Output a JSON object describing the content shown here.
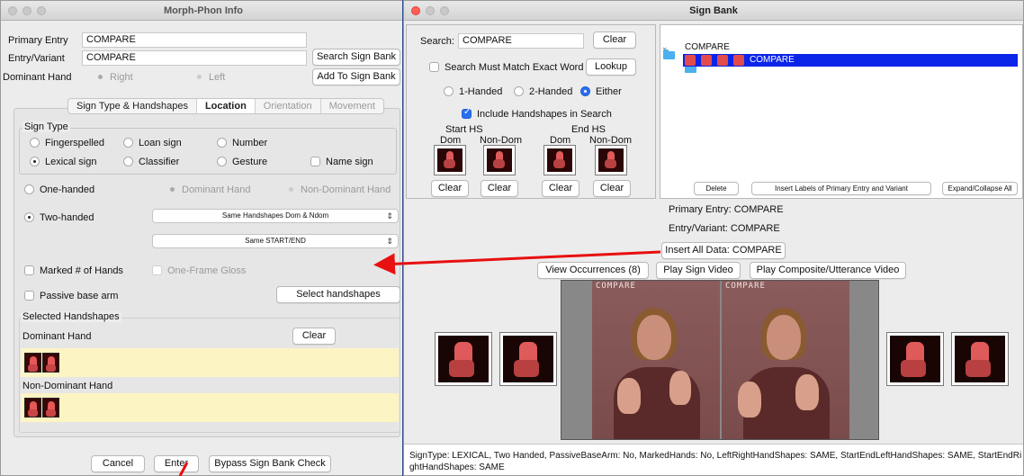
{
  "left_window": {
    "title": "Morph-Phon Info",
    "primary_entry_label": "Primary Entry",
    "primary_entry_value": "COMPARE",
    "entry_variant_label": "Entry/Variant",
    "entry_variant_value": "COMPARE",
    "search_sign_bank": "Search Sign Bank",
    "add_to_sign_bank": "Add To Sign Bank",
    "dominant_hand_label": "Dominant Hand",
    "right": "Right",
    "left": "Left",
    "tabs": [
      "Sign Type & Handshapes",
      "Location",
      "Orientation",
      "Movement"
    ],
    "sign_type_label": "Sign Type",
    "sign_types": [
      "Fingerspelled",
      "Loan sign",
      "Number",
      "Lexical sign",
      "Classifier",
      "Gesture",
      "Name sign"
    ],
    "one_handed": "One-handed",
    "dominant_hand_opt": "Dominant Hand",
    "non_dominant_hand_opt": "Non-Dominant Hand",
    "two_handed": "Two-handed",
    "select1": "Same Handshapes Dom & Ndom",
    "select2": "Same START/END",
    "marked_hands": "Marked # of Hands",
    "one_frame_gloss": "One-Frame Gloss",
    "passive_base_arm": "Passive base arm",
    "select_handshapes": "Select handshapes",
    "selected_handshapes_label": "Selected Handshapes",
    "dominant_hand_section": "Dominant Hand",
    "clear": "Clear",
    "non_dominant_hand_section": "Non-Dominant Hand",
    "cancel": "Cancel",
    "enter": "Enter",
    "bypass": "Bypass Sign Bank Check"
  },
  "right_window": {
    "title": "Sign Bank",
    "search_label": "Search:",
    "search_value": "COMPARE",
    "clear": "Clear",
    "exact_match": "Search Must Match Exact Word",
    "lookup": "Lookup",
    "one_handed": "1-Handed",
    "two_handed": "2-Handed",
    "either": "Either",
    "include_handshapes": "Include Handshapes in Search",
    "start_hs": "Start HS",
    "end_hs": "End HS",
    "dom": "Dom",
    "non_dom": "Non-Dom",
    "tree_root": "COMPARE",
    "tree_item": "COMPARE",
    "delete": "Delete",
    "insert_labels": "Insert Labels of Primary Entry and Variant",
    "expand_collapse": "Expand/Collapse All",
    "primary_entry_line": "Primary Entry: COMPARE",
    "entry_variant_line": "Entry/Variant: COMPARE",
    "insert_all_data": "Insert All Data: COMPARE",
    "view_occurrences": "View Occurrences (8)",
    "play_sign_video": "Play Sign Video",
    "play_composite": "Play Composite/Utterance Video",
    "video_label": "COMPARE",
    "status_line1": "SignType: LEXICAL, Two Handed, PassiveBaseArm: No, MarkedHands: No, LeftRightHandShapes: SAME, StartEndLeftHandShapes: SAME, StartEndRi",
    "status_line2": "ghtHandShapes: SAME"
  },
  "colors": {
    "arrow": "#e81010",
    "tree_selection": "#0a24e8",
    "handshape_panel": "#fdf4c4",
    "accent": "#2a6ff0"
  }
}
